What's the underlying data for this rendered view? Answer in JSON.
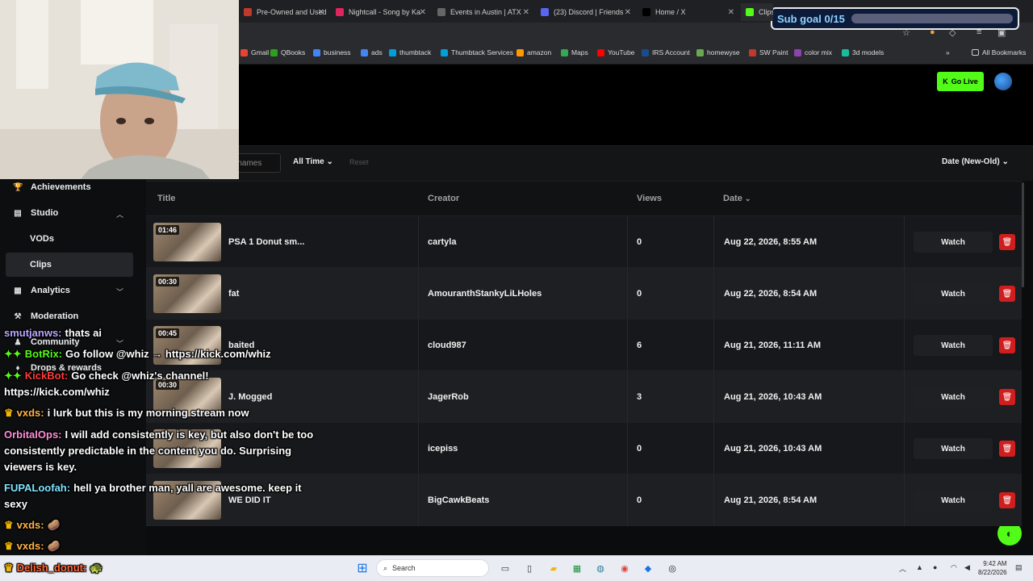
{
  "browser": {
    "tabs": [
      {
        "title": "Pre-Owned and Used T",
        "color": "#c0392b"
      },
      {
        "title": "Nightcall - Song by Ka",
        "color": "#e0245e"
      },
      {
        "title": "Events in Austin | ATX",
        "color": "#666666"
      },
      {
        "title": "(23) Discord | Friends",
        "color": "#5865f2"
      },
      {
        "title": "Home / X",
        "color": "#000000"
      },
      {
        "title": "Clips",
        "color": "#53fc18"
      }
    ],
    "bookmarks": [
      {
        "label": "Gmail",
        "color": "#ea4335"
      },
      {
        "label": "QBooks",
        "color": "#2ca01c"
      },
      {
        "label": "business",
        "color": "#4285f4"
      },
      {
        "label": "ads",
        "color": "#4285f4"
      },
      {
        "label": "thumbtack",
        "color": "#009fd9"
      },
      {
        "label": "Thumbtack Services",
        "color": "#009fd9"
      },
      {
        "label": "amazon",
        "color": "#ff9900"
      },
      {
        "label": "Maps",
        "color": "#34a853"
      },
      {
        "label": "YouTube",
        "color": "#ff0000"
      },
      {
        "label": "IRS Account",
        "color": "#1a4b8c"
      },
      {
        "label": "homewyse",
        "color": "#6aa84f"
      },
      {
        "label": "SW Paint",
        "color": "#c0392b"
      },
      {
        "label": "color mix",
        "color": "#8e44ad"
      },
      {
        "label": "3d models",
        "color": "#1abc9c"
      }
    ],
    "all_bookmarks": "All Bookmarks"
  },
  "overlay": {
    "sub_goal": "Sub goal 0/15",
    "sub_goal_progress": 0
  },
  "header": {
    "go_live": "Go Live"
  },
  "filters": {
    "usernames_placeholder": "rnames",
    "time_range": "All Time",
    "reset": "Reset",
    "sort": "Date (New-Old)"
  },
  "sidebar": {
    "items": [
      {
        "label": "Achievements",
        "icon": "trophy-icon",
        "glyph": "🏆"
      },
      {
        "label": "Studio",
        "icon": "film-icon",
        "glyph": "▤"
      },
      {
        "label": "VODs",
        "icon": "",
        "glyph": ""
      },
      {
        "label": "Clips",
        "icon": "",
        "glyph": ""
      },
      {
        "label": "Analytics",
        "icon": "chart-icon",
        "glyph": "▦"
      },
      {
        "label": "Moderation",
        "icon": "hammer-icon",
        "glyph": "⚒"
      },
      {
        "label": "Community",
        "icon": "users-icon",
        "glyph": "♟"
      },
      {
        "label": "Drops & rewards",
        "icon": "gift-icon",
        "glyph": "♦"
      }
    ]
  },
  "table": {
    "headers": {
      "title": "Title",
      "creator": "Creator",
      "views": "Views",
      "date": "Date"
    },
    "watch_label": "Watch",
    "rows": [
      {
        "duration": "01:46",
        "title": "PSA 1 Donut sm...",
        "creator": "cartyla",
        "views": "0",
        "date": "Aug 22, 2026, 8:55 AM"
      },
      {
        "duration": "00:30",
        "title": "fat",
        "creator": "AmouranthStankyLiLHoles",
        "views": "0",
        "date": "Aug 22, 2026, 8:54 AM"
      },
      {
        "duration": "00:45",
        "title": "baited",
        "creator": "cloud987",
        "views": "6",
        "date": "Aug 21, 2026, 11:11 AM"
      },
      {
        "duration": "00:30",
        "title": "J. Mogged",
        "creator": "JagerRob",
        "views": "3",
        "date": "Aug 21, 2026, 10:43 AM"
      },
      {
        "duration": "",
        "title": "",
        "creator": "icepiss",
        "views": "0",
        "date": "Aug 21, 2026, 10:43 AM"
      },
      {
        "duration": "",
        "title": "WE DID IT",
        "creator": "BigCawkBeats",
        "views": "0",
        "date": "Aug 21, 2026, 8:54 AM"
      }
    ]
  },
  "chat": [
    {
      "user": "smutjanws:",
      "color": "#b9a6ff",
      "text": "thats ai"
    },
    {
      "user": "BotRix:",
      "color": "#53fc18",
      "text": "Go follow @whiz → https://kick.com/whiz",
      "prefix": "✦✦"
    },
    {
      "user": "KickBot:",
      "color": "#ff3b3b",
      "text": "Go check @whiz's channel!",
      "prefix": "✦✦"
    },
    {
      "user": "",
      "color": "#ffffff",
      "text": "https://kick.com/whiz"
    },
    {
      "user": "vxds:",
      "color": "#ffb347",
      "text": "i lurk but this is my morning stream now",
      "prefix": "♛"
    },
    {
      "user": "OrbitalOps:",
      "color": "#ff8fd8",
      "text": "I will add consistently is key, but also don't be too"
    },
    {
      "user": "",
      "color": "#ffffff",
      "text": "consistently predictable in the content you do. Surprising"
    },
    {
      "user": "",
      "color": "#ffffff",
      "text": "viewers is key."
    },
    {
      "user": "FUPALoofah:",
      "color": "#7fe3ff",
      "text": "hell ya brother man, yall are awesome. keep it"
    },
    {
      "user": "",
      "color": "#ffffff",
      "text": "sexy"
    },
    {
      "user": "vxds:",
      "color": "#ffb347",
      "text": "🥔",
      "prefix": "♛"
    },
    {
      "user": "vxds:",
      "color": "#ffb347",
      "text": "🥔",
      "prefix": "♛"
    },
    {
      "user": "Delish_donut:",
      "color": "#ff6a3d",
      "text": "🐢",
      "prefix": "♛"
    }
  ],
  "taskbar": {
    "search": "Search",
    "time": "9:42 AM",
    "date": "8/22/2026"
  }
}
